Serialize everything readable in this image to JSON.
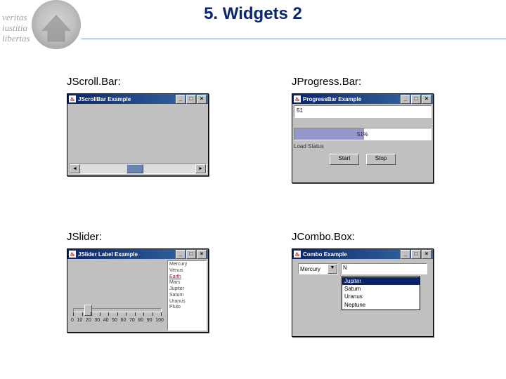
{
  "header": {
    "title": "5. Widgets  2",
    "motto": [
      "veritas",
      "iustitia",
      "libertas"
    ]
  },
  "labels": {
    "scroll": "JScroll.Bar:",
    "progress": "JProgress.Bar:",
    "slider": "JSlider:",
    "combo": "JCombo.Box:"
  },
  "scrollbar": {
    "title": "JScrollBar Example",
    "buttons": {
      "min": "_",
      "max": "□",
      "close": "×"
    },
    "arrow_left": "◄",
    "arrow_right": "►"
  },
  "progress": {
    "title": "ProgressBar Example",
    "buttons": {
      "min": "_",
      "max": "□",
      "close": "×"
    },
    "value": "51",
    "percent": "51%",
    "label": "Load Status",
    "start": "Start",
    "stop": "Stop"
  },
  "slider": {
    "title": "JSlider Label Example",
    "buttons": {
      "min": "_",
      "max": "□",
      "close": "×"
    },
    "ticks": [
      "0",
      "10",
      "20",
      "30",
      "40",
      "50",
      "60",
      "70",
      "80",
      "90",
      "100"
    ],
    "planets": [
      "Mercury",
      "Venus",
      "Earth",
      "Mars",
      "Jupiter",
      "Saturn",
      "Uranus",
      "Pluto"
    ],
    "focus_index": 2
  },
  "combo": {
    "title": "Combo Example",
    "buttons": {
      "min": "_",
      "max": "□",
      "close": "×"
    },
    "selected": "Mercury",
    "arrow": "▼",
    "textfield": "N",
    "options": [
      "Jupiter",
      "Saturn",
      "Uranus",
      "Neptune"
    ]
  }
}
